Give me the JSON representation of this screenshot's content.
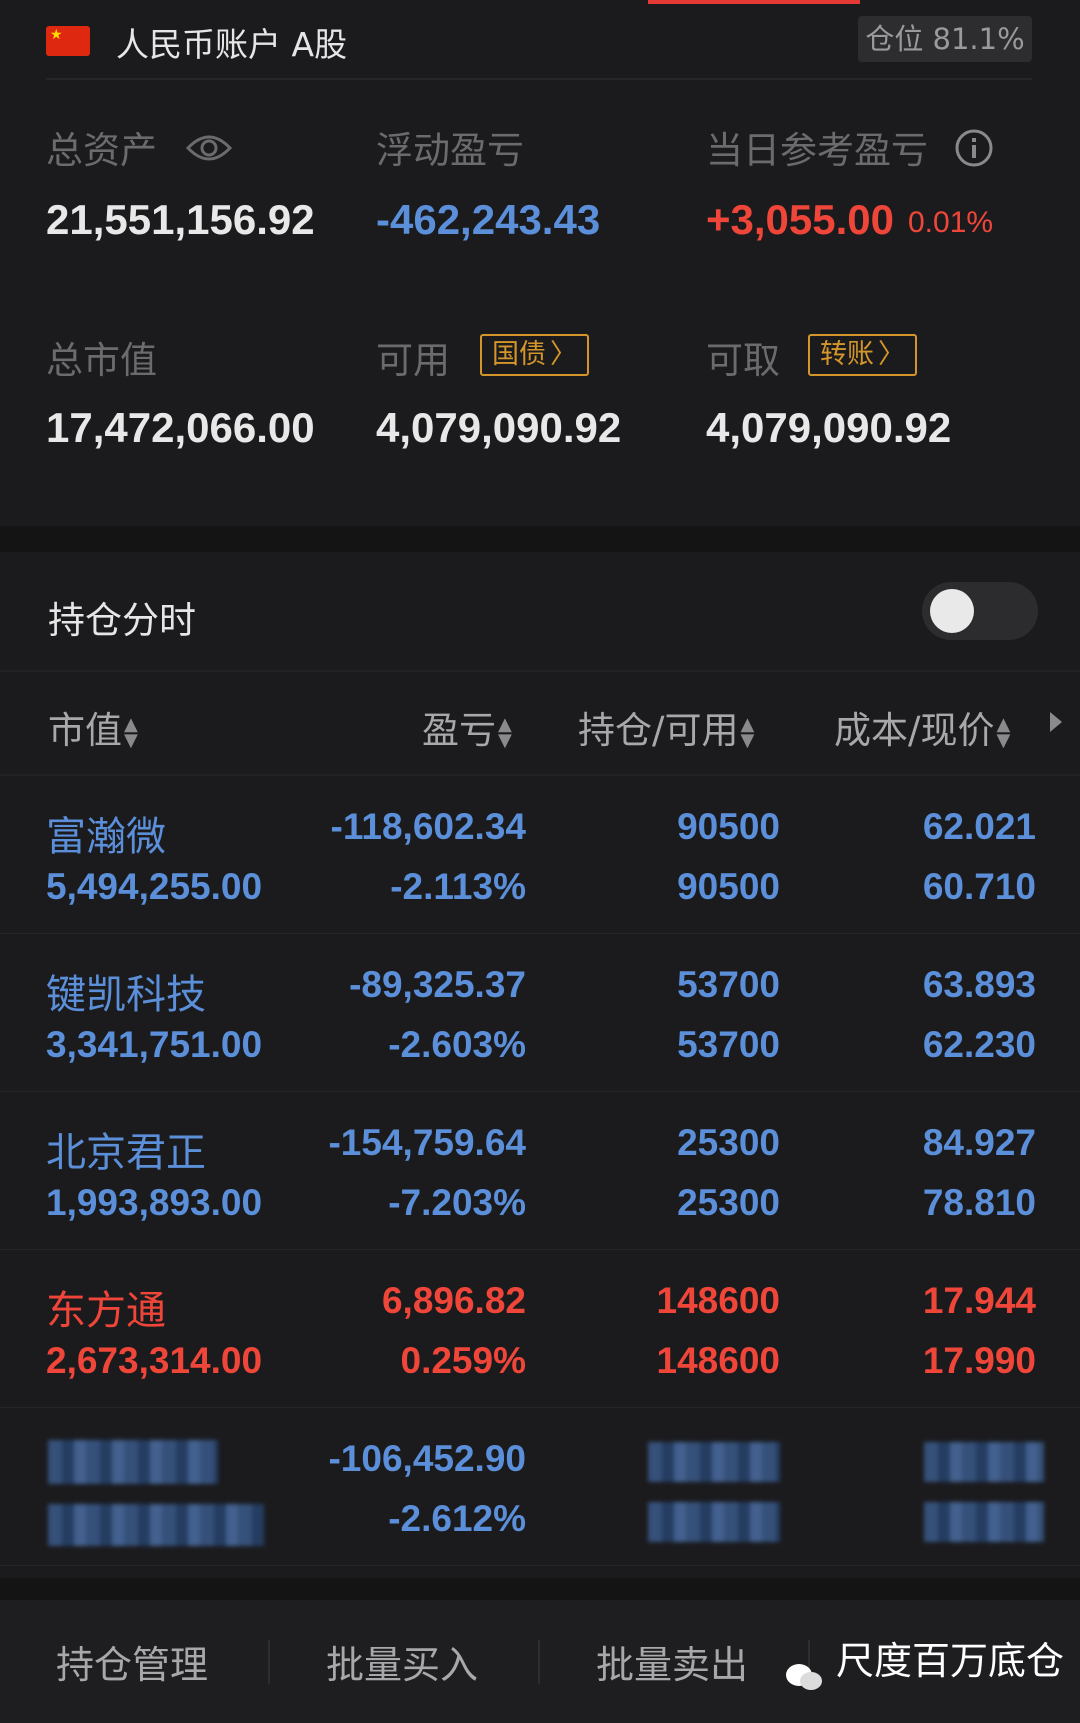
{
  "account": {
    "title": "人民币账户 A股",
    "position_badge": "仓位 81.1%"
  },
  "summary": {
    "total_assets_label": "总资产",
    "total_assets": "21,551,156.92",
    "floating_pl_label": "浮动盈亏",
    "floating_pl": "-462,243.43",
    "daily_pl_label": "当日参考盈亏",
    "daily_pl": "+3,055.00",
    "daily_pl_pct": "0.01%",
    "market_value_label": "总市值",
    "market_value": "17,472,066.00",
    "available_label": "可用",
    "available": "4,079,090.92",
    "bond_tag": "国债",
    "withdrawable_label": "可取",
    "withdrawable": "4,079,090.92",
    "transfer_tag": "转账"
  },
  "section": {
    "title": "持仓分时",
    "toggle_on": false
  },
  "table": {
    "headers": [
      "市值",
      "盈亏",
      "持仓/可用",
      "成本/现价"
    ],
    "rows": [
      {
        "name": "富瀚微",
        "value": "5,494,255.00",
        "pl": "-118,602.34",
        "pl_pct": "-2.113%",
        "hold": "90500",
        "avail": "90500",
        "cost": "62.021",
        "price": "60.710",
        "color": "#5b8fd9"
      },
      {
        "name": "键凯科技",
        "value": "3,341,751.00",
        "pl": "-89,325.37",
        "pl_pct": "-2.603%",
        "hold": "53700",
        "avail": "53700",
        "cost": "63.893",
        "price": "62.230",
        "color": "#5b8fd9"
      },
      {
        "name": "北京君正",
        "value": "1,993,893.00",
        "pl": "-154,759.64",
        "pl_pct": "-7.203%",
        "hold": "25300",
        "avail": "25300",
        "cost": "84.927",
        "price": "78.810",
        "color": "#5b8fd9"
      },
      {
        "name": "东方通",
        "value": "2,673,314.00",
        "pl": "6,896.82",
        "pl_pct": "0.259%",
        "hold": "148600",
        "avail": "148600",
        "cost": "17.944",
        "price": "17.990",
        "color": "#f0463a"
      },
      {
        "name": "",
        "value": "",
        "pl": "-106,452.90",
        "pl_pct": "-2.612%",
        "hold": "",
        "avail": "",
        "cost": "",
        "price": "",
        "color": "#5b8fd9"
      }
    ]
  },
  "bottom_tabs": [
    "持仓管理",
    "批量买入",
    "批量卖出"
  ],
  "watermark": "尺度百万底仓",
  "colors": {
    "up": "#f0463a",
    "down": "#5b8fd9",
    "tag": "#d4952a"
  }
}
